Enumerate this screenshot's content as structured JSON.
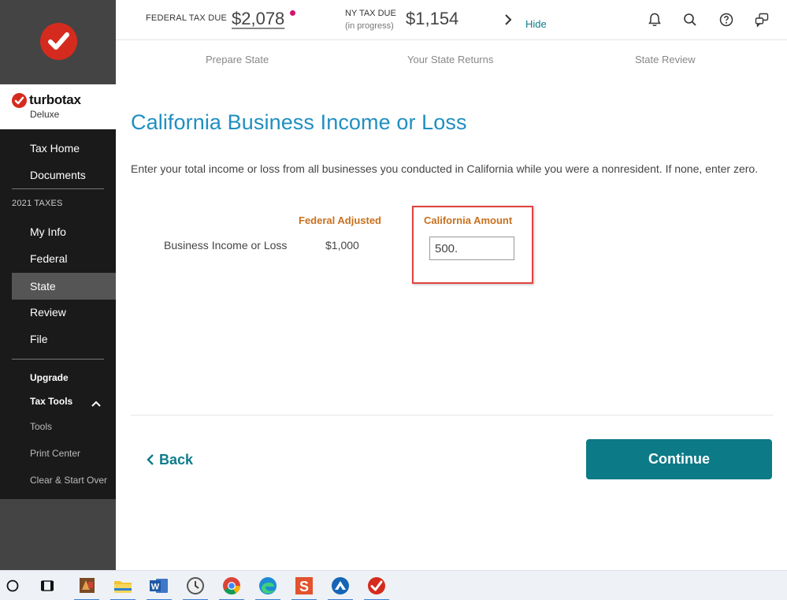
{
  "header": {
    "federal_label": "FEDERAL TAX DUE",
    "federal_value": "$2,078",
    "ny_label": "NY TAX DUE",
    "ny_sub": "(in progress)",
    "ny_value": "$1,154",
    "hide_label": "Hide",
    "icons": [
      "bell-icon",
      "search-icon",
      "help-icon",
      "chat-icon"
    ]
  },
  "steps": [
    "Prepare State",
    "Your State Returns",
    "State Review"
  ],
  "sidebar": {
    "brand_name": "turbotax",
    "edition": "Deluxe",
    "items_top": [
      {
        "label": "Tax Home"
      },
      {
        "label": "Documents"
      }
    ],
    "section_label": "2021 TAXES",
    "items_main": [
      {
        "label": "My Info"
      },
      {
        "label": "Federal"
      },
      {
        "label": "State"
      },
      {
        "label": "Review"
      },
      {
        "label": "File"
      }
    ],
    "upgrade": "Upgrade",
    "tax_tools": "Tax Tools",
    "tools": [
      "Tools",
      "Print Center",
      "Clear & Start Over"
    ],
    "active": "State"
  },
  "main": {
    "title": "California Business Income or Loss",
    "intro": "Enter your total income or loss from all businesses you conducted in California while you were a nonresident. If none, enter zero.",
    "col_federal": "Federal Adjusted",
    "col_california": "California Amount",
    "row_label": "Business Income or Loss",
    "federal_amount": "$1,000",
    "california_amount": "500."
  },
  "buttons": {
    "back": "Back",
    "continue": "Continue"
  },
  "taskbar": {
    "items": [
      "start-circle-icon",
      "task-view-icon",
      "app-icon",
      "file-explorer-icon",
      "word-icon",
      "clock-app-icon",
      "chrome-icon",
      "edge-icon",
      "s-app-icon",
      "blue-app-icon",
      "turbotax-icon"
    ]
  },
  "colors": {
    "accent_teal": "#0d7a87",
    "title_blue": "#1f8fc1",
    "column_orange": "#c8701e",
    "highlight_red": "#e0433f",
    "brand_red": "#d52b1e"
  }
}
